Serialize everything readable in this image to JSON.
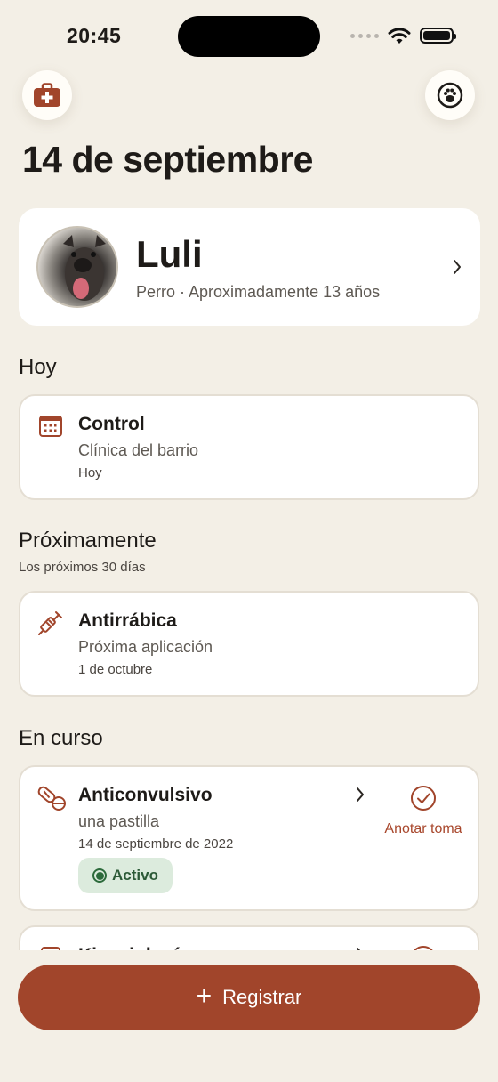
{
  "status_bar": {
    "time": "20:45"
  },
  "header": {
    "date_title": "14 de septiembre"
  },
  "pet": {
    "name": "Luli",
    "subtitle": "Perro · Aproximadamente 13 años"
  },
  "sections": {
    "today": {
      "title": "Hoy"
    },
    "upcoming": {
      "title": "Próximamente",
      "subtitle": "Los próximos 30 días"
    },
    "ongoing": {
      "title": "En curso"
    }
  },
  "today_card": {
    "title": "Control",
    "line": "Clínica del barrio",
    "small": "Hoy"
  },
  "upcoming_card": {
    "title": "Antirrábica",
    "line": "Próxima aplicación",
    "small": "1 de octubre"
  },
  "ongoing_card": {
    "title": "Anticonvulsivo",
    "line": "una pastilla",
    "small": "14 de septiembre de 2022",
    "badge": "Activo",
    "action": "Anotar toma"
  },
  "partial_card": {
    "title": "Kinesiología"
  },
  "register_button": {
    "label": "Registrar"
  },
  "colors": {
    "accent": "#A1452B",
    "background": "#F3EFE6",
    "badge_bg": "#DCEBDD",
    "badge_text": "#2C5A37"
  },
  "icons": {
    "left_button": "first-aid-kit-icon",
    "right_button": "paw-icon",
    "today": "calendar-icon",
    "upcoming": "syringe-icon",
    "ongoing": "pills-icon",
    "action": "checkmark-circle-icon"
  }
}
